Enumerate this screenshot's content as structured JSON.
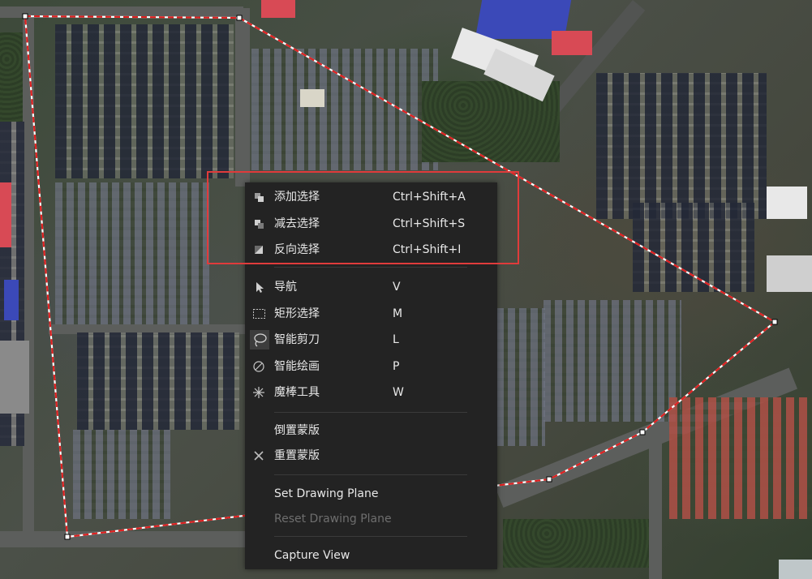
{
  "menu": {
    "items": [
      {
        "label": "添加选择",
        "shortcut": "Ctrl+Shift+A",
        "icon": "add-selection-icon",
        "enabled": true
      },
      {
        "label": "减去选择",
        "shortcut": "Ctrl+Shift+S",
        "icon": "subtract-selection-icon",
        "enabled": true
      },
      {
        "label": "反向选择",
        "shortcut": "Ctrl+Shift+I",
        "icon": "invert-selection-icon",
        "enabled": true
      },
      {
        "label": "导航",
        "shortcut": "V",
        "icon": "navigate-pointer-icon",
        "enabled": true
      },
      {
        "label": "矩形选择",
        "shortcut": "M",
        "icon": "rectangle-select-icon",
        "enabled": true
      },
      {
        "label": "智能剪刀",
        "shortcut": "L",
        "icon": "lasso-icon",
        "enabled": true,
        "active": true
      },
      {
        "label": "智能绘画",
        "shortcut": "P",
        "icon": "smart-paint-icon",
        "enabled": true
      },
      {
        "label": "魔棒工具",
        "shortcut": "W",
        "icon": "magic-wand-icon",
        "enabled": true
      },
      {
        "label": "倒置蒙版",
        "shortcut": "",
        "icon": "",
        "enabled": true
      },
      {
        "label": "重置蒙版",
        "shortcut": "",
        "icon": "close-icon",
        "enabled": true
      },
      {
        "label": "Set Drawing Plane",
        "shortcut": "",
        "icon": "",
        "enabled": true
      },
      {
        "label": "Reset Drawing Plane",
        "shortcut": "",
        "icon": "",
        "enabled": false
      },
      {
        "label": "Capture View",
        "shortcut": "",
        "icon": "",
        "enabled": true
      }
    ]
  },
  "colors": {
    "menu_background": "#232323",
    "menu_text": "#e8e8e8",
    "disabled_text": "#6e6e6e",
    "highlight_border": "#e03b3b",
    "selection_polygon": "#e02020"
  }
}
